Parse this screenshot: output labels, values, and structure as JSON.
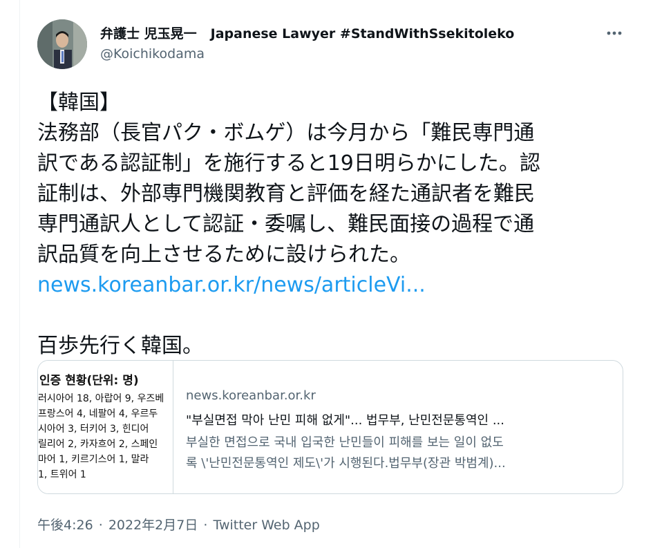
{
  "author": {
    "display_name": "弁護士 児玉晃一",
    "bio_title": "Japanese Lawyer #StandWithSsekitoleko",
    "handle": "@Koichikodama"
  },
  "icons": {
    "more": "more-horizontal-icon",
    "avatar": "profile-photo"
  },
  "tweet": {
    "lines": [
      "【韓国】",
      "法務部（長官パク・ボムゲ）は今月から「難民専門通",
      "訳である認証制」を施行すると19日明らかにした。認",
      "証制は、外部専門機関教育と評価を経た通訳者を難民",
      "専門通訳人として認証・委嘱し、難民面接の過程で通",
      "訳品質を向上させるために設けられた。"
    ],
    "link": "news.koreanbar.or.kr/news/articleVi...",
    "closing": "百歩先行く韓国。"
  },
  "card": {
    "thumbnail": {
      "title": "인증 현황(단위: 명)",
      "lines": [
        "러시아어 18, 아랍어 9, 우즈베",
        "프랑스어 4, 네팔어 4, 우르두",
        "시아어 3, 터키어 3, 힌디어",
        "릴리어 2, 카자흐어 2, 스페인",
        "마어 1, 키르기스어 1, 말라",
        "1, 트위어 1"
      ]
    },
    "domain": "news.koreanbar.or.kr",
    "title": "\"부실면접 막아 난민 피해 없게\"... 법무부, 난민전문통역인 ...",
    "description_lines": [
      "부실한 면접으로 국내 입국한 난민들이 피해를 보는 일이 없도",
      "록 \\'난민전문통역인 제도\\'가 시행된다.법무부(장관 박범계)..."
    ]
  },
  "meta": {
    "time": "午後4:26",
    "separator": "·",
    "date": "2022年2月7日",
    "source": "Twitter Web App"
  },
  "colors": {
    "link": "#1d9bf0",
    "secondary_text": "#536471",
    "border": "#cfd9de"
  }
}
